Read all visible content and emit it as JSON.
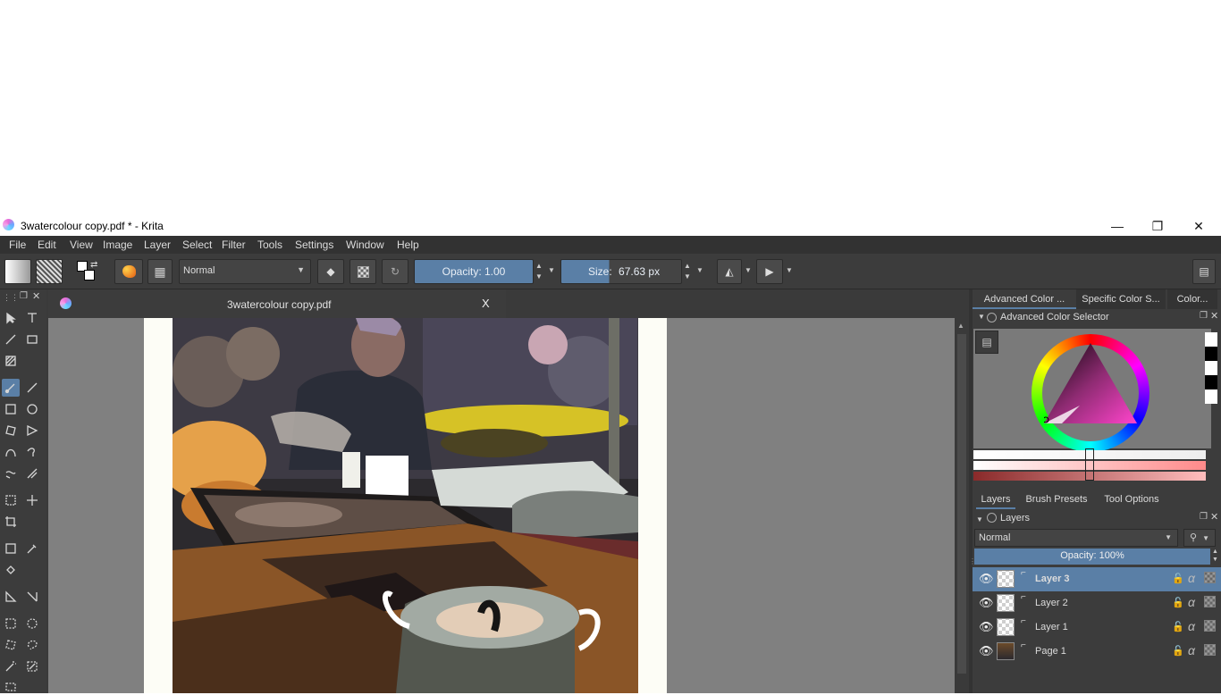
{
  "window": {
    "title": "3watercolour copy.pdf * - Krita",
    "minimize": "—",
    "restore": "❐",
    "close": "✕"
  },
  "menu": [
    "File",
    "Edit",
    "View",
    "Image",
    "Layer",
    "Select",
    "Filter",
    "Tools",
    "Settings",
    "Window",
    "Help"
  ],
  "toolbar": {
    "blend_mode": "Normal",
    "opacity_label": "Opacity:",
    "opacity_value": "1.00",
    "size_label": "Size:",
    "size_value": "67.63 px"
  },
  "document_tab": {
    "name": "3watercolour copy.pdf",
    "close": "X"
  },
  "right_dock": {
    "top_tabs": [
      "Advanced Color ...",
      "Specific Color S...",
      "Color..."
    ],
    "color_selector_title": "Advanced Color Selector",
    "mid_tabs": [
      "Layers",
      "Brush Presets",
      "Tool Options"
    ],
    "layers_title": "Layers",
    "layers_blend_mode": "Normal",
    "layers_opacity": "Opacity:  100%",
    "layers": [
      {
        "name": "Layer 3",
        "selected": true
      },
      {
        "name": "Layer 2",
        "selected": false
      },
      {
        "name": "Layer 1",
        "selected": false
      },
      {
        "name": "Page 1",
        "selected": false
      }
    ]
  },
  "colors": {
    "accent": "#5a7fa6",
    "panel": "#3c3c3c",
    "canvas_bg": "#808080"
  }
}
